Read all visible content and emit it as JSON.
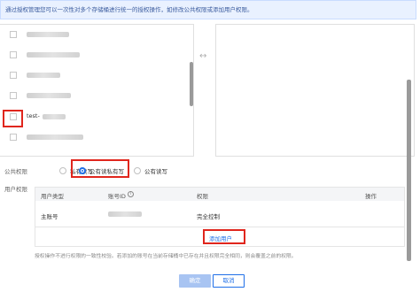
{
  "notice": "通过授权管理您可以一次性对多个存储桶进行统一的授权操作，如修改公共权限或添加用户权限。",
  "bucket_list": {
    "visible_label": "test-",
    "row_count": 6,
    "selected_row": 4
  },
  "transfer_icon": "↔",
  "public_permission": {
    "label": "公共权限",
    "options": [
      "私有读写",
      "公有读私有写",
      "公有读写"
    ],
    "selected": "公有读私有写"
  },
  "user_permission": {
    "label": "用户权限",
    "columns": [
      "用户类型",
      "账号ID",
      "权限",
      "操作"
    ],
    "rows": [
      {
        "type": "主账号",
        "permission": "完全控制"
      }
    ],
    "add_user_label": "添加用户"
  },
  "footnote": "授权操作不进行权限的一致性校验。若添加的账号在当前存储桶中已存在并且权限完全相同，则会覆盖之前的权限。",
  "buttons": {
    "confirm": "确定",
    "cancel": "取消"
  },
  "colors": {
    "accent": "#1f6fe8",
    "highlight": "#e0261d",
    "notice_bg": "#e9f1ff"
  }
}
